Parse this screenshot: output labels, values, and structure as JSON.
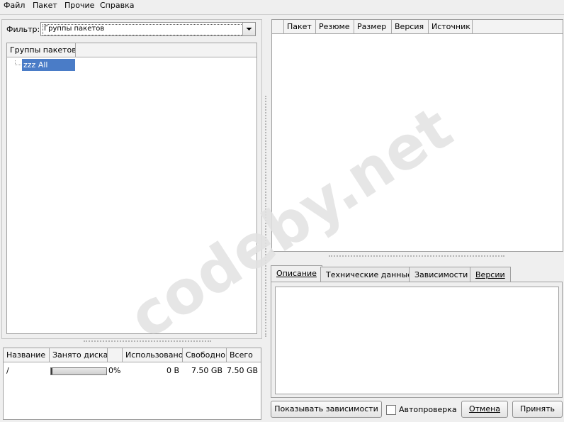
{
  "menu": {
    "file": "Файл",
    "package": "Пакет",
    "other": "Прочие",
    "help": "Справка"
  },
  "filter": {
    "label": "Фильтр:",
    "value": "Группы пакетов"
  },
  "groups_tree": {
    "header": "Группы пакетов",
    "items": [
      "zzz All"
    ]
  },
  "disk_table": {
    "headers": [
      "Название",
      "Занято диска",
      "",
      "Использовано",
      "Свободно",
      "Всего"
    ],
    "rows": [
      {
        "name": "/",
        "used_percent_label": "0%",
        "used_fraction": 0.0,
        "used": "0 B",
        "free": "7.50 GB",
        "total": "7.50 GB"
      }
    ]
  },
  "packages_table": {
    "headers": [
      "",
      "Пакет",
      "Резюме",
      "Размер",
      "Версия",
      "Источник"
    ]
  },
  "details_tabs": [
    "Описание",
    "Технические данные",
    "Зависимости",
    "Версии"
  ],
  "buttons": {
    "show_deps": "Показывать зависимости",
    "autocheck": "Автопроверка",
    "cancel": "Отмена",
    "apply": "Принять"
  },
  "watermark": "codeby.net",
  "colors": {
    "selection": "#4a7cc7",
    "watermark": "#e2e2e2"
  }
}
